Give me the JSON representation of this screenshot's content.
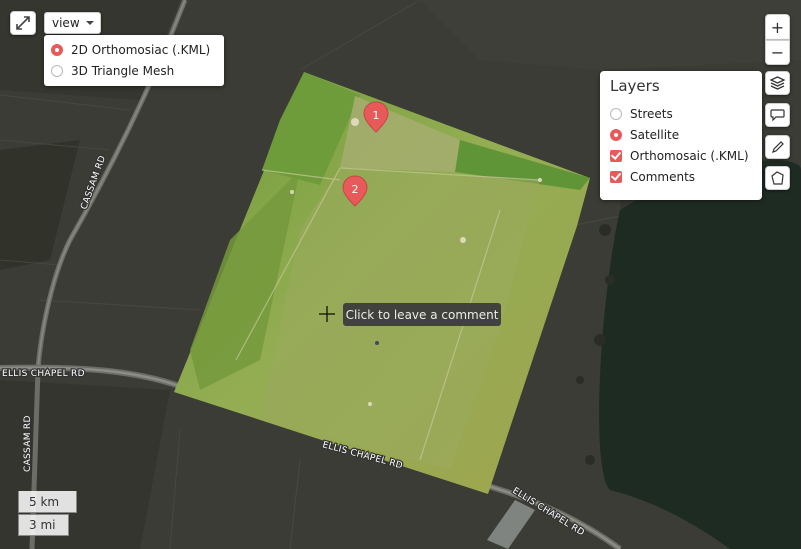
{
  "map": {
    "roads": [
      "CASSAM RD",
      "ELLIS CHAPEL RD",
      "ELLIS CHAPEL RD",
      "ELLIS CHAPEL RD",
      "CASSAM RD"
    ],
    "markers": [
      "1",
      "2"
    ],
    "tooltip": "Click to leave a comment"
  },
  "view_menu": {
    "label": "view",
    "options": [
      {
        "label": "2D Orthomosiac (.KML)",
        "selected": true
      },
      {
        "label": "3D Triangle Mesh",
        "selected": false
      }
    ]
  },
  "zoom": {
    "in": "+",
    "out": "−"
  },
  "layers": {
    "title": "Layers",
    "items": [
      {
        "label": "Streets",
        "type": "radio",
        "checked": false
      },
      {
        "label": "Satellite",
        "type": "radio",
        "checked": true
      },
      {
        "label": "Orthomosaic (.KML)",
        "type": "checkbox",
        "checked": true
      },
      {
        "label": "Comments",
        "type": "checkbox",
        "checked": true
      }
    ]
  },
  "tools": [
    "layers-icon",
    "comment-icon",
    "pencil-icon",
    "polygon-icon",
    "expand-icon"
  ],
  "scale": {
    "metric": "5 km",
    "imperial": "3 mi"
  },
  "colors": {
    "accent": "#e85a5a",
    "water": "#1d2a22",
    "field": "#8fb04a"
  }
}
